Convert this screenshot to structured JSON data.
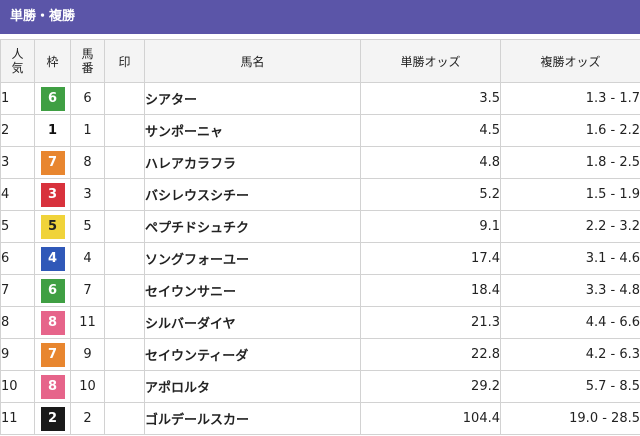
{
  "section_title": "単勝・複勝",
  "columns": {
    "rank_line1": "人",
    "rank_line2": "気",
    "waku": "枠",
    "number_line1": "馬",
    "number_line2": "番",
    "mark": "印",
    "name": "馬名",
    "win": "単勝オッズ",
    "place": "複勝オッズ"
  },
  "rows": [
    {
      "rank": "1",
      "waku": "6",
      "number": "6",
      "mark": "",
      "name": "シアター",
      "win": "3.5",
      "place": "1.3 - 1.7",
      "win_hot": true,
      "place_hot": true
    },
    {
      "rank": "2",
      "waku": "1",
      "number": "1",
      "mark": "",
      "name": "サンポーニャ",
      "win": "4.5",
      "place": "1.6 - 2.2",
      "win_hot": true,
      "place_hot": true
    },
    {
      "rank": "3",
      "waku": "7",
      "number": "8",
      "mark": "",
      "name": "ハレアカラフラ",
      "win": "4.8",
      "place": "1.8 - 2.5",
      "win_hot": true,
      "place_hot": true
    },
    {
      "rank": "4",
      "waku": "3",
      "number": "3",
      "mark": "",
      "name": "バシレウスシチー",
      "win": "5.2",
      "place": "1.5 - 1.9",
      "win_hot": true,
      "place_hot": true
    },
    {
      "rank": "5",
      "waku": "5",
      "number": "5",
      "mark": "",
      "name": "ペプチドシュチク",
      "win": "9.1",
      "place": "2.2 - 3.2",
      "win_hot": true,
      "place_hot": true
    },
    {
      "rank": "6",
      "waku": "4",
      "number": "4",
      "mark": "",
      "name": "ソングフォーユー",
      "win": "17.4",
      "place": "3.1 - 4.6",
      "win_hot": false,
      "place_hot": true
    },
    {
      "rank": "7",
      "waku": "6",
      "number": "7",
      "mark": "",
      "name": "セイウンサニー",
      "win": "18.4",
      "place": "3.3 - 4.8",
      "win_hot": false,
      "place_hot": true
    },
    {
      "rank": "8",
      "waku": "8",
      "number": "11",
      "mark": "",
      "name": "シルバーダイヤ",
      "win": "21.3",
      "place": "4.4 - 6.6",
      "win_hot": false,
      "place_hot": true
    },
    {
      "rank": "9",
      "waku": "7",
      "number": "9",
      "mark": "",
      "name": "セイウンティーダ",
      "win": "22.8",
      "place": "4.2 - 6.3",
      "win_hot": false,
      "place_hot": true
    },
    {
      "rank": "10",
      "waku": "8",
      "number": "10",
      "mark": "",
      "name": "アポロルタ",
      "win": "29.2",
      "place": "5.7 - 8.5",
      "win_hot": false,
      "place_hot": true
    },
    {
      "rank": "11",
      "waku": "2",
      "number": "2",
      "mark": "",
      "name": "ゴルデールスカー",
      "win": "104.4",
      "place": "19.0 - 28.5",
      "win_hot": false,
      "place_hot": false
    }
  ],
  "colors": {
    "header_bg": "#5b55a8",
    "horse_name": "#1b2fa6",
    "hot_odds": "#d9434c",
    "waku_1": "#ffffff",
    "waku_2": "#1a1a1a",
    "waku_3": "#d8323c",
    "waku_4": "#2f58b8",
    "waku_5": "#f0d33a",
    "waku_6": "#3f9f43",
    "waku_7": "#e8862f",
    "waku_8": "#e6648a"
  }
}
